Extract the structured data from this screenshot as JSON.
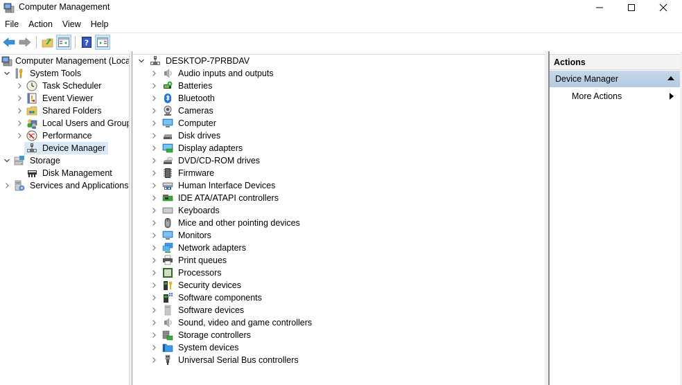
{
  "window": {
    "title": "Computer Management",
    "controls": {
      "minimize": "minimize",
      "maximize": "maximize",
      "close": "close"
    }
  },
  "menu": [
    "File",
    "Action",
    "View",
    "Help"
  ],
  "toolbar": {
    "buttons": [
      {
        "name": "back",
        "icon": "back-arrow-icon"
      },
      {
        "name": "forward",
        "icon": "forward-arrow-icon"
      },
      {
        "name": "up-one-level",
        "icon": "folder-up-icon"
      },
      {
        "name": "show-hide-console-tree",
        "icon": "console-tree-icon",
        "pressed": true
      },
      {
        "name": "help",
        "icon": "help-icon"
      },
      {
        "name": "show-hide-action-pane",
        "icon": "action-pane-icon",
        "pressed": true
      }
    ]
  },
  "left_tree": {
    "root": "Computer Management (Local",
    "items": [
      {
        "label": "System Tools",
        "level": 1,
        "expanded": true,
        "icon": "tools-icon"
      },
      {
        "label": "Task Scheduler",
        "level": 2,
        "icon": "clock-icon"
      },
      {
        "label": "Event Viewer",
        "level": 2,
        "icon": "event-viewer-icon"
      },
      {
        "label": "Shared Folders",
        "level": 2,
        "icon": "shared-folder-icon"
      },
      {
        "label": "Local Users and Groups",
        "level": 2,
        "icon": "users-icon"
      },
      {
        "label": "Performance",
        "level": 2,
        "icon": "performance-icon"
      },
      {
        "label": "Device Manager",
        "level": 2,
        "icon": "device-manager-icon",
        "selected": true,
        "leaf": true
      },
      {
        "label": "Storage",
        "level": 1,
        "expanded": true,
        "icon": "storage-icon"
      },
      {
        "label": "Disk Management",
        "level": 2,
        "icon": "disk-icon",
        "leaf": true
      },
      {
        "label": "Services and Applications",
        "level": 1,
        "icon": "services-icon"
      }
    ]
  },
  "device_tree": {
    "root": "DESKTOP-7PRBDAV",
    "categories": [
      "Audio inputs and outputs",
      "Batteries",
      "Bluetooth",
      "Cameras",
      "Computer",
      "Disk drives",
      "Display adapters",
      "DVD/CD-ROM drives",
      "Firmware",
      "Human Interface Devices",
      "IDE ATA/ATAPI controllers",
      "Keyboards",
      "Mice and other pointing devices",
      "Monitors",
      "Network adapters",
      "Print queues",
      "Processors",
      "Security devices",
      "Software components",
      "Software devices",
      "Sound, video and game controllers",
      "Storage controllers",
      "System devices",
      "Universal Serial Bus controllers"
    ]
  },
  "actions": {
    "header": "Actions",
    "section": "Device Manager",
    "items": [
      "More Actions"
    ]
  }
}
